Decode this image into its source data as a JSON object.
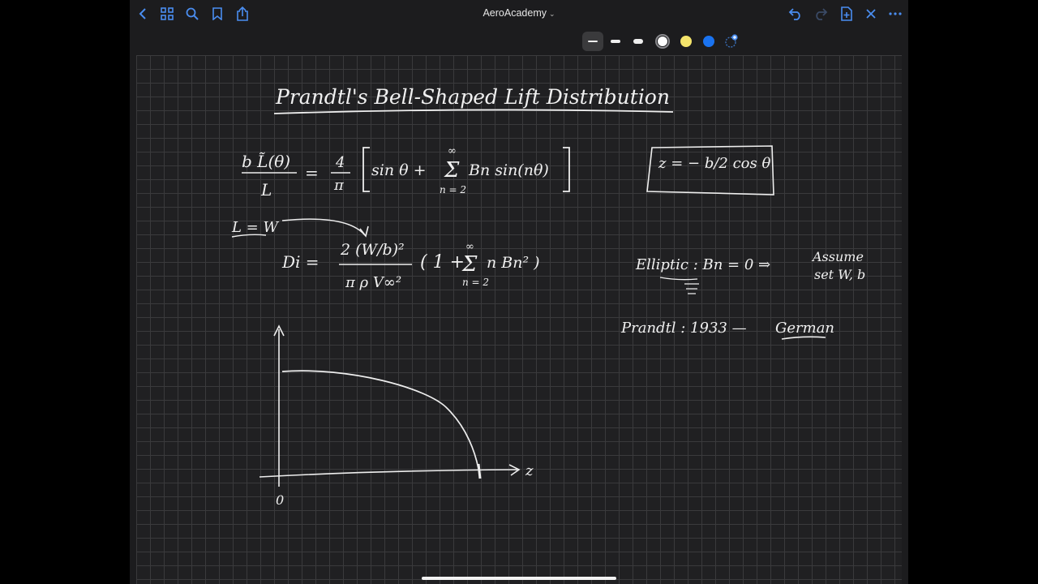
{
  "app": {
    "title": "AeroAcademy",
    "accent": "#4a8df0"
  },
  "topbar": {
    "left_icons": [
      "back-icon",
      "grid-icon",
      "search-icon",
      "bookmark-icon",
      "share-icon"
    ],
    "right_icons": [
      "undo-icon",
      "redo-icon",
      "add-page-icon",
      "close-icon",
      "more-icon"
    ]
  },
  "toolbar": {
    "tools": [
      "lasso-image-tool",
      "pen-tool",
      "eraser-tool",
      "highlighter-tool",
      "shapes-tool",
      "lasso-tool",
      "sticker-tool",
      "image-tool",
      "text-tool",
      "laser-tool"
    ],
    "colors": [
      "#ffffff",
      "#f4e46b",
      "#1a73f0"
    ]
  },
  "notes": {
    "heading": "Prandtl's Bell-Shaped Lift Distribution",
    "eq1_lhs_num": "b L̃(θ)",
    "eq1_lhs_den": "L",
    "eq1_eq": "=",
    "eq1_coef_num": "4",
    "eq1_coef_den": "π",
    "eq1_body": "sin θ  +",
    "eq1_sum_top": "∞",
    "eq1_sum_bot": "n = 2",
    "eq1_term": "Bn sin(nθ)",
    "box_eq": "z = − b/2 cos θ",
    "lw": "L = W",
    "di_lhs": "Di =",
    "di_num": "2 (W/b)²",
    "di_den": "π ρ V∞²",
    "di_paren": "( 1 +",
    "di_sum_top": "∞",
    "di_sum_bot": "n = 2",
    "di_term": "n Bn² )",
    "elliptic": "Elliptic :   Bn = 0   ⇒",
    "assume_1": "Assume",
    "assume_2": "set  W, b",
    "prandtl_year": "Prandtl : 1933   —",
    "german": "German",
    "axis_z": "z",
    "axis_origin": "0"
  }
}
